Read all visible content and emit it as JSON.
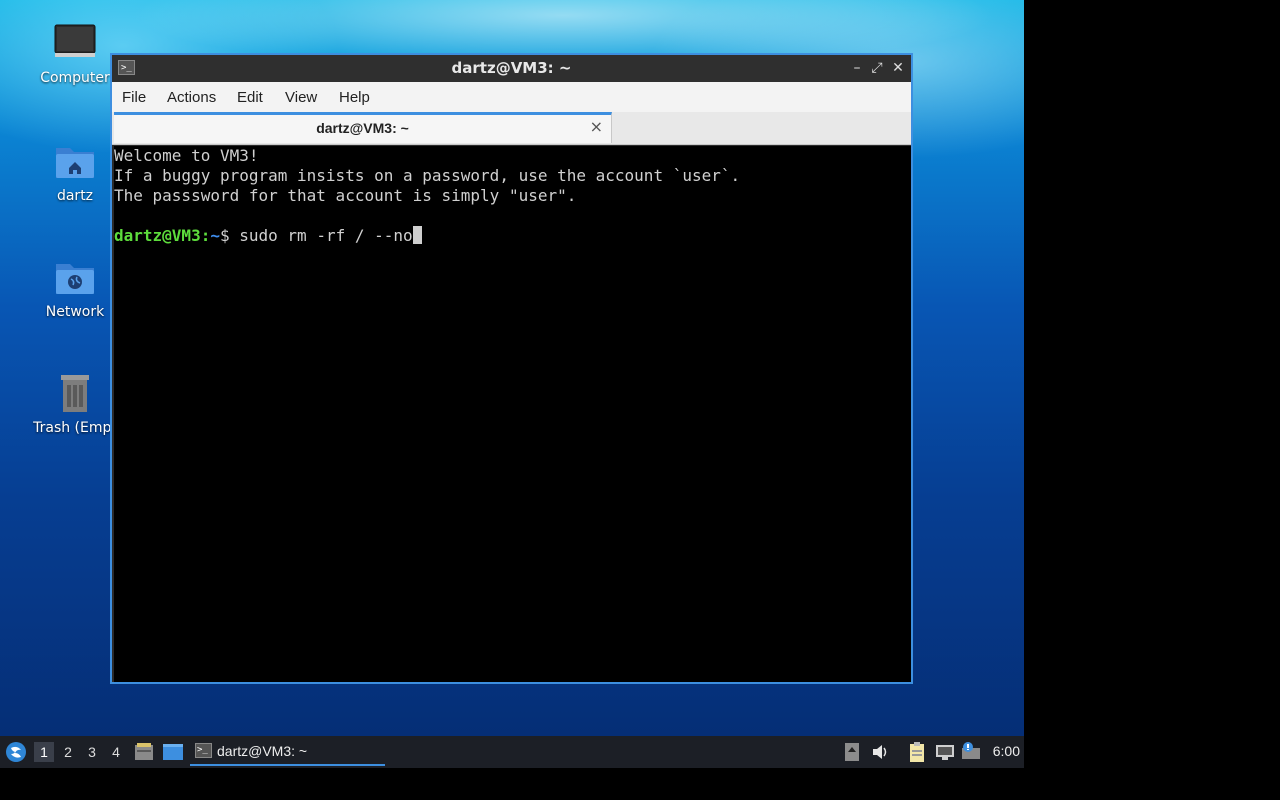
{
  "desktop": {
    "icons": [
      {
        "label": "Computer",
        "icon": "computer-icon"
      },
      {
        "label": "dartz",
        "icon": "home-folder-icon"
      },
      {
        "label": "Network",
        "icon": "network-folder-icon"
      },
      {
        "label": "Trash (Empt",
        "icon": "trash-icon"
      }
    ]
  },
  "window": {
    "title": "dartz@VM3: ~",
    "controls": {
      "minimize": "–",
      "maximize": "⤢",
      "close": "✕"
    },
    "menu": [
      "File",
      "Actions",
      "Edit",
      "View",
      "Help"
    ],
    "tab": {
      "title": "dartz@VM3: ~",
      "close": "×"
    }
  },
  "terminal": {
    "lines": [
      "Welcome to VM3!",
      "If a buggy program insists on a password, use the account `user`.",
      "The passsword for that account is simply \"user\"."
    ],
    "prompt": {
      "user_host": "dartz@VM3",
      "sep": ":",
      "dir": "~",
      "symbol": "$ "
    },
    "command": "sudo rm -rf / --no"
  },
  "taskbar": {
    "workspaces": [
      "1",
      "2",
      "3",
      "4"
    ],
    "active_workspace": "1",
    "task_label": "dartz@VM3: ~",
    "clock": "6:00"
  },
  "colors": {
    "accent": "#3d8fe0",
    "prompt_user": "#5ddc3c",
    "prompt_dir": "#3f8ff0"
  }
}
